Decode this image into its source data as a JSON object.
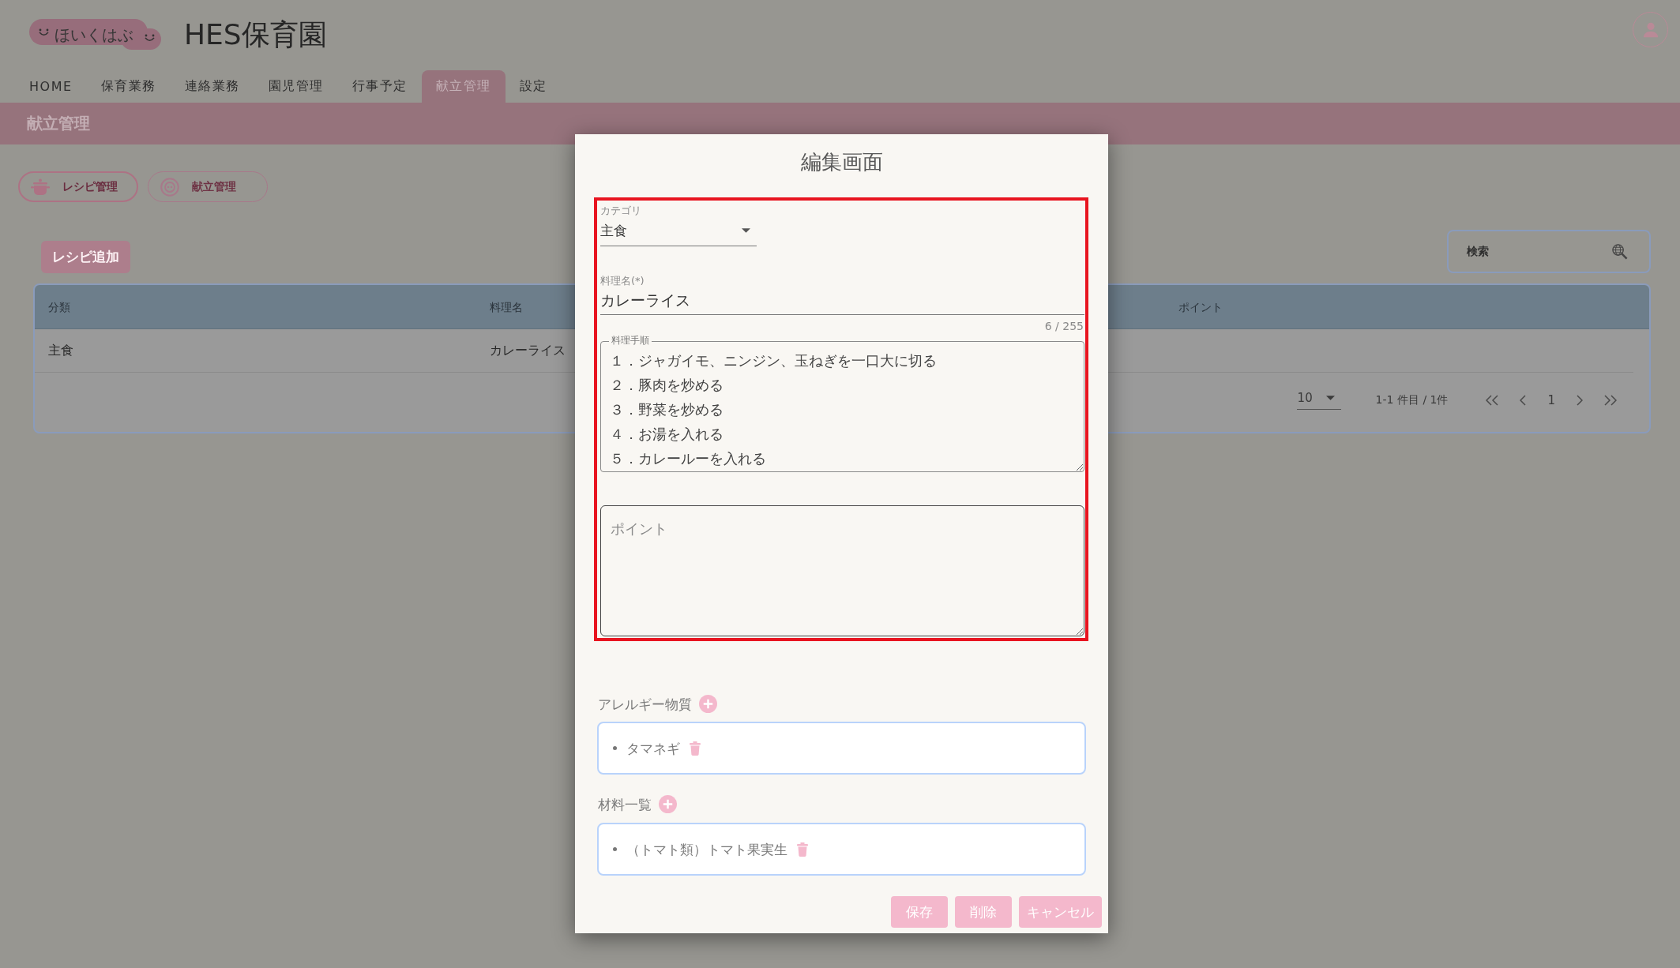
{
  "header": {
    "logo": "ほいくはぶ",
    "title": "HES保育園"
  },
  "nav": [
    {
      "label": "HOME",
      "selected": false
    },
    {
      "label": "保育業務",
      "selected": false
    },
    {
      "label": "連絡業務",
      "selected": false
    },
    {
      "label": "園児管理",
      "selected": false
    },
    {
      "label": "行事予定",
      "selected": false
    },
    {
      "label": "献立管理",
      "selected": true
    },
    {
      "label": "設定",
      "selected": false
    }
  ],
  "page_title": "献立管理",
  "sub_nav": [
    {
      "label": "レシピ管理",
      "selected": true
    },
    {
      "label": "献立管理",
      "selected": false
    }
  ],
  "add_button": "レシピ追加",
  "search": {
    "placeholder": "検索"
  },
  "table": {
    "columns": [
      "分類",
      "料理名",
      "ポイント"
    ],
    "rows": [
      [
        "主食",
        "カレーライス"
      ]
    ]
  },
  "pagination": {
    "page_size": "10",
    "range": "1-1 件目 / 1件",
    "page": "1"
  },
  "dialog": {
    "title": "編集画面",
    "form": {
      "highlighted": true,
      "category": {
        "label": "カテゴリ",
        "value": "主食"
      },
      "dish_name": {
        "label": "料理名(*)",
        "value": "カレーライス",
        "counter": "6 / 255"
      },
      "steps": {
        "label": "料理手順",
        "lines": [
          "１．ジャガイモ、ニンジン、玉ねぎを一口大に切る",
          "２．豚肉を炒める",
          "３．野菜を炒める",
          "４．お湯を入れる",
          "５．カレールーを入れる"
        ]
      },
      "point": {
        "placeholder": "ポイント"
      }
    },
    "allergens": {
      "label": "アレルギー物質",
      "items": [
        "タマネギ"
      ]
    },
    "ingredients": {
      "label": "材料一覧",
      "items": [
        "（トマト類）トマト果実生"
      ]
    },
    "buttons": [
      "保存",
      "削除",
      "キャンセル"
    ]
  }
}
